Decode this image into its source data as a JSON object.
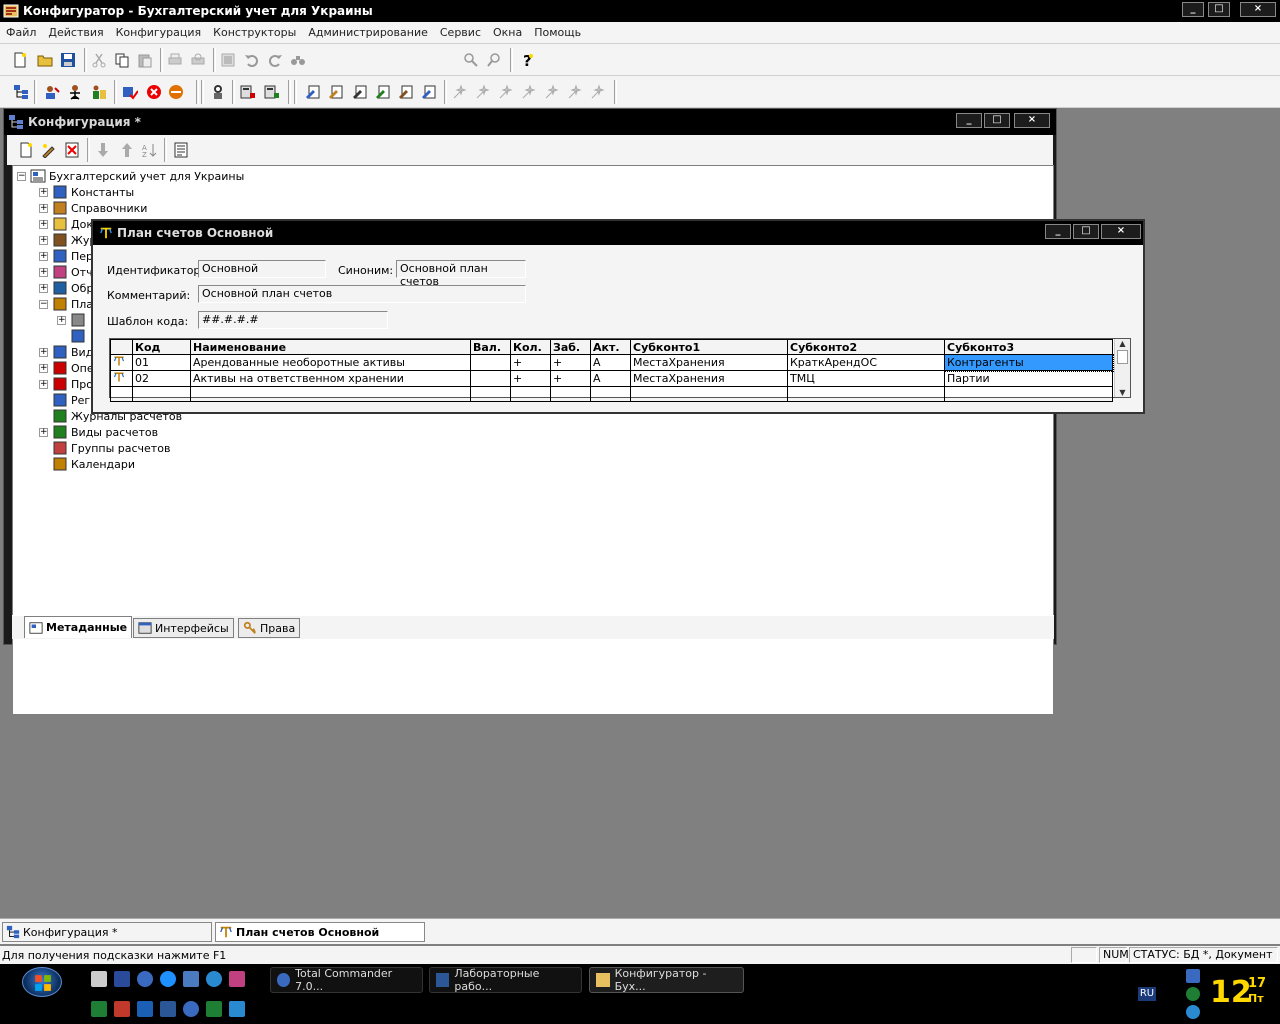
{
  "app": {
    "title": "Конфигуратор - Бухгалтерский учет для Украины",
    "window_buttons": [
      "_",
      "□",
      "×"
    ]
  },
  "menu": [
    "Файл",
    "Действия",
    "Конфигурация",
    "Конструкторы",
    "Администрирование",
    "Сервис",
    "Окна",
    "Помощь"
  ],
  "config_window": {
    "title": "Конфигурация *",
    "tree": {
      "root": "Бухгалтерский учет для Украины",
      "items": [
        {
          "label": "Константы",
          "expander": "+"
        },
        {
          "label": "Справочники",
          "expander": "+"
        },
        {
          "label": "Документы",
          "expander": "+"
        },
        {
          "label": "Журналы документов",
          "expander": "+"
        },
        {
          "label": "Перечисления",
          "expander": "+"
        },
        {
          "label": "Отчеты",
          "expander": "+"
        },
        {
          "label": "Обработки",
          "expander": "+"
        },
        {
          "label": "Планы счетов",
          "expander": "−"
        },
        {
          "label": "",
          "expander": "+"
        },
        {
          "label": "",
          "expander": ""
        },
        {
          "label": "Виды субконто",
          "expander": "+"
        },
        {
          "label": "Операции",
          "expander": "+"
        },
        {
          "label": "Проводки",
          "expander": "+"
        },
        {
          "label": "Регистры",
          "expander": ""
        },
        {
          "label": "Журналы расчетов",
          "expander": ""
        },
        {
          "label": "Виды расчетов",
          "expander": "+"
        },
        {
          "label": "Группы расчетов",
          "expander": ""
        },
        {
          "label": "Календари",
          "expander": ""
        }
      ]
    },
    "tabs": [
      "Метаданные",
      "Интерфейсы",
      "Права"
    ]
  },
  "dialog": {
    "title": "План счетов Основной",
    "identifier_label": "Идентификатор:",
    "identifier_value": "Основной",
    "synonym_label": "Синоним:",
    "synonym_value": "Основной план счетов",
    "comment_label": "Комментарий:",
    "comment_value": "Основной план счетов",
    "template_label": "Шаблон  кода:",
    "template_value": "##.#.#.#",
    "columns": [
      "",
      "Код",
      "Наименование",
      "Вал.",
      "Кол.",
      "Заб.",
      "Акт.",
      "Субконто1",
      "Субконто2",
      "Субконто3"
    ],
    "rows": [
      [
        "",
        "01",
        "Арендованные необоротные активы",
        "",
        "+",
        "+",
        "А",
        "МестаХранения",
        "КраткАрендОС",
        "Контрагенты"
      ],
      [
        "",
        "02",
        "Активы на ответственном хранении",
        "",
        "+",
        "+",
        "А",
        "МестаХранения",
        "ТМЦ",
        "Партии"
      ],
      [
        "",
        "",
        "",
        "",
        "",
        "",
        "",
        "",
        "",
        ""
      ]
    ]
  },
  "mdi_tabs": [
    "Конфигурация *",
    "План счетов Основной"
  ],
  "status": {
    "hint": "Для получения подсказки нажмите F1",
    "num": "NUM",
    "status": "СТАТУС: БД *, Документ *"
  },
  "taskbar": {
    "buttons": [
      "Total Commander 7.0...",
      "Лабораторные рабо...",
      "Конфигуратор - Бух..."
    ],
    "lang": "RU",
    "clock_hour": "12",
    "clock_minute": "17",
    "clock_day": "Пт"
  },
  "colors": {
    "selection": "#3399ff",
    "workspace": "#808080",
    "clock": "#ffd800"
  }
}
